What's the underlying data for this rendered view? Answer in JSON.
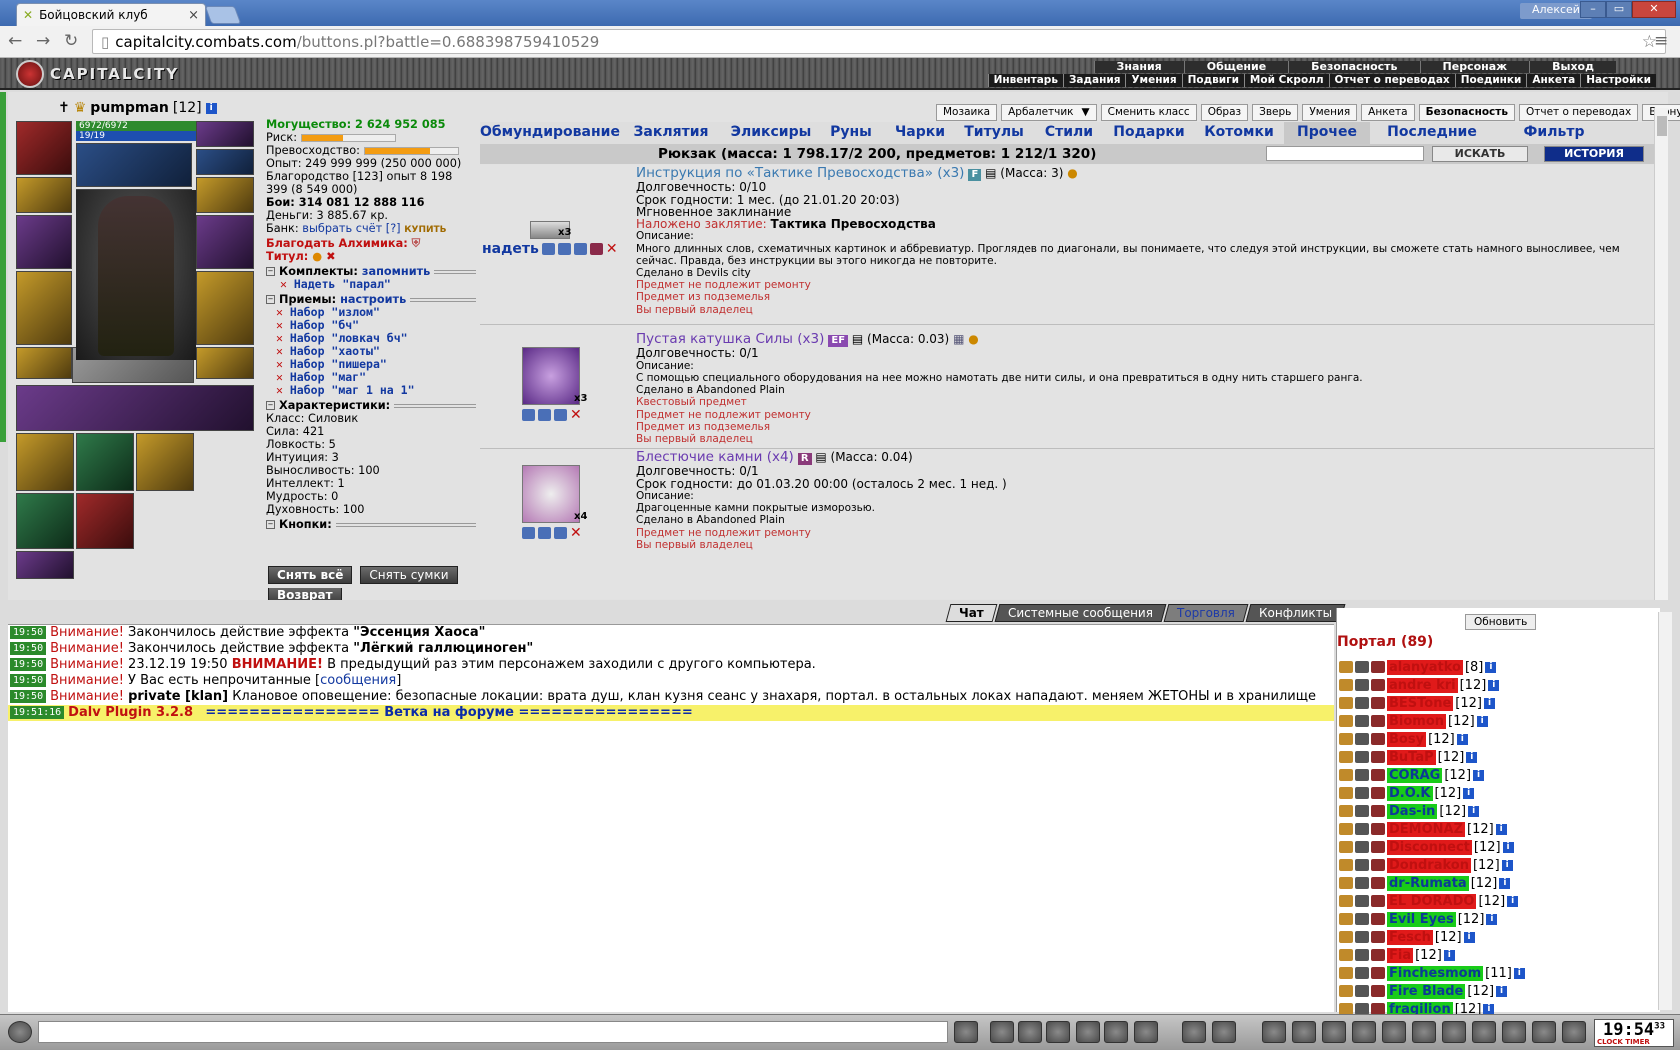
{
  "browser": {
    "tab_title": "Бойцовский клуб",
    "user": "Алексей",
    "url_domain": "capitalcity.combats.com",
    "url_path": "/buttons.pl?battle=0.688398759410529"
  },
  "header": {
    "logo": "CAPITALCITY",
    "nav_top": [
      "Знания",
      "Общение",
      "Безопасность",
      "Персонаж",
      "Выход"
    ],
    "nav_bottom": [
      "Инвентарь",
      "Задания",
      "Умения",
      "Подвиги",
      "Мой Скролл",
      "Отчет о переводах",
      "Поединки",
      "Анкета",
      "Настройки"
    ]
  },
  "character": {
    "name": "pumpman",
    "level": "[12]",
    "hp": "6972/6972",
    "mana": "19/19"
  },
  "stats": {
    "power_label": "Могущество:",
    "power_value": "2 624 952 085",
    "risk_label": "Риск:",
    "superiority_label": "Превосходство:",
    "exp": "Опыт: 249 999 999 (250 000 000)",
    "nobility": "Благородство [123] опыт 8 198 399 (8 549 000)",
    "fights": "Бои:  314 081    12 888    116",
    "money": "Деньги: 3 885.67 кр.",
    "bank_label": "Банк:",
    "bank_link": "выбрать счёт",
    "bank_help": "[?]",
    "buy": "КУПИТЬ",
    "alchemist": "Благодать Алхимика:",
    "title_label": "Титул:",
    "risk_pct": 45,
    "sup_pct": 70
  },
  "sections": {
    "sets_label": "Комплекты:",
    "sets_link": "запомнить",
    "set_items": [
      "Надеть \"парал\""
    ],
    "moves_label": "Приемы:",
    "moves_link": "настроить",
    "move_items": [
      "Набор \"излом\"",
      "Набор \"бч\"",
      "Набор \"ловкач бч\"",
      "Набор \"хаоты\"",
      "Набор \"пишера\"",
      "Набор \"маг\"",
      "Набор \"маг 1 на 1\""
    ],
    "chars_label": "Характеристики:",
    "class": "Класс: Силовик",
    "attrs": [
      "Сила: 421",
      "Ловкость: 5",
      "Интуиция: 3",
      "Выносливость: 100",
      "Интеллект: 1",
      "Мудрость: 0",
      "Духовность: 100"
    ],
    "buttons_label": "Кнопки:",
    "btn_remove_all": "Снять всё",
    "btn_remove_bags": "Снять сумки",
    "btn_return": "Возврат"
  },
  "topbuttons": [
    "Мозаика",
    "Арбалетчик",
    "Сменить класс",
    "Образ",
    "Зверь",
    "Умения",
    "Анкета",
    "Безопасность",
    "Отчет о переводах",
    "Вернуться"
  ],
  "inventory": {
    "tabs": [
      "Обмундирование",
      "Заклятия",
      "Эликсиры",
      "Руны",
      "Чарки",
      "Титулы",
      "Стили",
      "Подарки",
      "Котомки",
      "Прочее",
      "Последние",
      "Фильтр"
    ],
    "active_tab": "Прочее",
    "backpack": "Рюкзак (масса: 1 798.17/2 200, предметов: 1 212/1 320)",
    "find": "ИСКАТЬ",
    "history": "ИСТОРИЯ",
    "wear": "надеть",
    "items": [
      {
        "name": "Инструкция по «Тактике Превосходства» (x3)",
        "badge": "F",
        "mass": "(Масса: 3)",
        "count": "x3",
        "lines": [
          "Долговечность: 0/10",
          "Срок годности: 1 мес. (до 21.01.20 20:03)",
          "Мгновенное заклинание"
        ],
        "spell_label": "Наложено заклятие:",
        "spell": "Тактика Превосходства",
        "desc_label": "Описание:",
        "desc": "Много длинных слов, схематичных картинок и аббревиатур. Проглядев по диагонали, вы понимаете, что следуя этой инструкции, вы сможете стать намного выносливее, чем сейчас. Правда, без инструкции вы этого никогда не повторите.",
        "made": "Сделано в Devils city",
        "red": [
          "Предмет не подлежит ремонту",
          "Предмет из подземелья",
          "Вы первый владелец"
        ]
      },
      {
        "name": "Пустая катушка Силы (x3)",
        "badge": "EF",
        "mass": "(Масса: 0.03)",
        "count": "x3",
        "lines": [
          "Долговечность: 0/1"
        ],
        "desc_label": "Описание:",
        "desc": "С помощью специального оборудования на нее можно намотать две нити силы, и она превратиться в одну нить старшего ранга.",
        "made": "Сделано в Abandoned Plain",
        "red": [
          "Квестовый предмет",
          "Предмет не подлежит ремонту",
          "Предмет из подземелья",
          "Вы первый владелец"
        ]
      },
      {
        "name": "Блестючие камни (x4)",
        "badge": "R",
        "mass": "(Масса: 0.04)",
        "count": "x4",
        "lines": [
          "Долговечность: 0/1",
          "Срок годности: до 01.03.20 00:00 (осталось 2 мес. 1 нед. )"
        ],
        "desc_label": "Описание:",
        "desc": "Драгоценные камни покрытые изморозью.",
        "made": "Сделано в Abandoned Plain",
        "red": [
          "Предмет не подлежит ремонту",
          "Вы первый владелец"
        ]
      }
    ]
  },
  "chat": {
    "tabs": [
      "Чат",
      "Системные сообщения",
      "Торговля",
      "Конфликты"
    ],
    "lines": [
      {
        "time": "19:50",
        "warn": "Внимание!",
        "text": " Закончилось действие эффекта ",
        "bold": "\"Эссенция Хаоса\""
      },
      {
        "time": "19:50",
        "warn": "Внимание!",
        "text": " Закончилось действие эффекта ",
        "bold": "\"Лёгкий галлюциноген\""
      },
      {
        "time": "19:50",
        "warn": "Внимание!",
        "text": " 23.12.19 19:50 ",
        "bold2": "ВНИМАНИЕ!",
        "text2": " В предыдущий раз этим персонажем заходили с другого компьютера."
      },
      {
        "time": "19:50",
        "warn": "Внимание!",
        "text": " У Вас есть непрочитанные [",
        "link": "сообщения",
        "text2": "]"
      },
      {
        "time": "19:50",
        "warn": "Внимание!",
        "text": " ",
        "bold": "private [klan]",
        "text2": " Клановое оповещение: безопасные локации: врата душ, клан кузня сеанс у знахаря, портал. в остальных локах нападают. меняем ЖЕТОНЫ и в хранилище"
      }
    ],
    "plugin_time": "19:51:16",
    "plugin_name": "Dalv Plugin 3.2.8",
    "plugin_link": "================ Ветка на форуме ================"
  },
  "portal": {
    "refresh": "Обновить",
    "title": "Портал (89)",
    "players": [
      {
        "name": "alanyatko",
        "lvl": "[8]",
        "c": "red"
      },
      {
        "name": "andre kri",
        "lvl": "[12]",
        "c": "red"
      },
      {
        "name": "BESTone",
        "lvl": "[12]",
        "c": "red"
      },
      {
        "name": "Biomon",
        "lvl": "[12]",
        "c": "red"
      },
      {
        "name": "Bosy",
        "lvl": "[12]",
        "c": "red"
      },
      {
        "name": "BuTaP",
        "lvl": "[12]",
        "c": "red"
      },
      {
        "name": "CORAG",
        "lvl": "[12]",
        "c": "green"
      },
      {
        "name": "D.O.K",
        "lvl": "[12]",
        "c": "green"
      },
      {
        "name": "Das-in",
        "lvl": "[12]",
        "c": "green"
      },
      {
        "name": "DEMONAZ",
        "lvl": "[12]",
        "c": "red"
      },
      {
        "name": "Disconnect",
        "lvl": "[12]",
        "c": "red"
      },
      {
        "name": "Dondrakon",
        "lvl": "[12]",
        "c": "red"
      },
      {
        "name": "dr-Rumata",
        "lvl": "[12]",
        "c": "green"
      },
      {
        "name": "EL DORADO",
        "lvl": "[12]",
        "c": "red"
      },
      {
        "name": "Evil Eyes",
        "lvl": "[12]",
        "c": "green"
      },
      {
        "name": "Fesch",
        "lvl": "[12]",
        "c": "red"
      },
      {
        "name": "Fia",
        "lvl": "[12]",
        "c": "red"
      },
      {
        "name": "Finchesmom",
        "lvl": "[11]",
        "c": "green"
      },
      {
        "name": "Fire Blade",
        "lvl": "[12]",
        "c": "green"
      },
      {
        "name": "fragilion",
        "lvl": "[12]",
        "c": "green"
      }
    ]
  },
  "clock": {
    "time": "19:54",
    "sec": "33",
    "label": "CLOCK TIMER"
  }
}
